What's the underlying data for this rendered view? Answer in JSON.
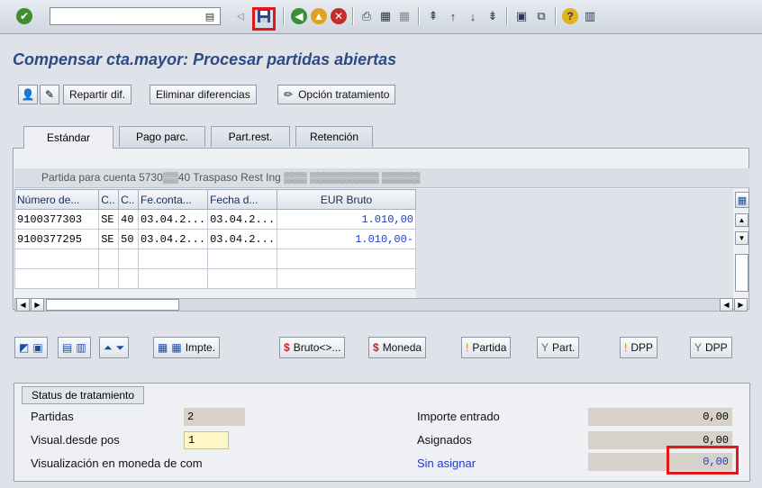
{
  "toolbar": {
    "icons": [
      "check-icon",
      "save-icon",
      "back-icon",
      "exit-icon",
      "cancel-icon",
      "print-icon",
      "find-icon",
      "find-next-icon",
      "first-page-icon",
      "prev-page-icon",
      "next-page-icon",
      "last-page-icon",
      "new-session-icon",
      "shortcut-icon",
      "help-icon",
      "layout-icon"
    ]
  },
  "title": "Compensar cta.mayor: Procesar partidas abiertas",
  "app_toolbar": {
    "repartir": "Repartir dif.",
    "eliminar": "Eliminar diferencias",
    "opcion": "Opción tratamiento"
  },
  "tabs": [
    "Estándar",
    "Pago parc.",
    "Part.rest.",
    "Retención"
  ],
  "grid": {
    "caption": "Partida para cuenta 5730▒▒40 Traspaso Rest Ing ▒▒▒ ▒▒▒▒▒▒▒▒▒ ▒▒▒▒▒",
    "headers": [
      "Número de...",
      "C..",
      "C..",
      "Fe.conta...",
      "Fecha d...",
      "EUR Bruto"
    ],
    "rows": [
      [
        "9100377303",
        "SE",
        "40",
        "03.04.2...",
        "03.04.2...",
        "1.010,00"
      ],
      [
        "9100377295",
        "SE",
        "50",
        "03.04.2...",
        "03.04.2...",
        "1.010,00-"
      ]
    ]
  },
  "buttons": {
    "impte": "Impte.",
    "bruto": "Bruto<>...",
    "moneda": "Moneda",
    "partida": "Partida",
    "part": "Part.",
    "dpp1": "DPP",
    "dpp2": "DPP"
  },
  "status": {
    "tab": "Status de tratamiento",
    "partidas_label": "Partidas",
    "partidas_value": "2",
    "visual_label": "Visual.desde pos",
    "visual_value": "1",
    "moneda_label": "Visualización en moneda de com",
    "importe_label": "Importe entrado",
    "importe_value": "0,00",
    "asignados_label": "Asignados",
    "asignados_value": "0,00",
    "sin_asignar_label": "Sin asignar",
    "sin_asignar_value": "0,00"
  },
  "colors": {
    "title": "#2c4a84",
    "highlight": "#e2171b",
    "amount": "#1f3ccc"
  }
}
